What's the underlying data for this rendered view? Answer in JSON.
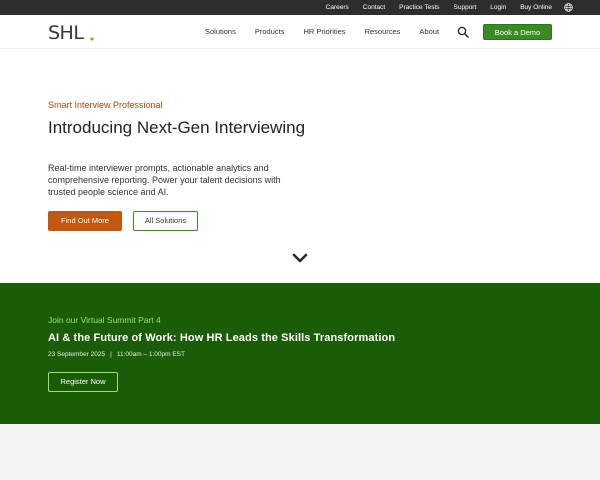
{
  "topbar": {
    "links": [
      "Careers",
      "Contact",
      "Practice Tests",
      "Support",
      "Login",
      "Buy Online"
    ],
    "globe_icon": "globe-icon"
  },
  "nav": {
    "logo_text": "SHL",
    "items": [
      "Solutions",
      "Products",
      "HR Priorities",
      "Resources",
      "About"
    ],
    "search_icon": "search-icon",
    "demo_label": "Book a Demo"
  },
  "hero": {
    "eyebrow": "Smart Interview Professional",
    "headline": "Introducing Next-Gen Interviewing",
    "subtext": "Real-time interviewer prompts, actionable analytics and comprehensive reporting. Power your talent decisions with trusted people science and AI.",
    "primary_cta": "Find Out More",
    "secondary_cta": "All Solutions",
    "scroll_icon": "chevron-down-icon"
  },
  "summit": {
    "eyebrow": "Join our Virtual Summit Part 4",
    "title": "AI & the Future of Work: How HR Leads the Skills Transformation",
    "date": "23 September 2025",
    "separator": "|",
    "time": "11:00am – 1:00pm EST",
    "cta": "Register Now"
  },
  "colors": {
    "topbar": "#2b2d2f",
    "accent_orange": "#c2570f",
    "brand_green": "#3a8a25",
    "summit_bg": "#1b5c09",
    "summit_accent": "#9fe06f"
  }
}
